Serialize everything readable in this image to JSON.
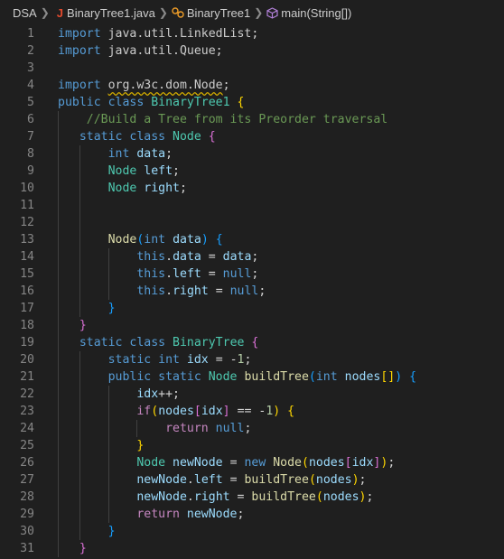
{
  "breadcrumb": {
    "folder": "DSA",
    "java_letter": "J",
    "file": "BinaryTree1.java",
    "class_name": "BinaryTree1",
    "method": "main(String[])"
  },
  "icons": [
    "chevron-right-icon",
    "java-file-icon",
    "class-icon",
    "method-cube-icon"
  ],
  "colors": {
    "background": "#1f1f1f",
    "keyword": "#569cd6",
    "type": "#4ec9b0",
    "comment": "#6a9955"
  },
  "lines": [
    {
      "n": "1",
      "t": [
        [
          "import ",
          "kw"
        ],
        [
          "java.util.LinkedList",
          "pkg"
        ],
        [
          ";",
          "op"
        ]
      ]
    },
    {
      "n": "2",
      "t": [
        [
          "import ",
          "kw"
        ],
        [
          "java.util.Queue",
          "pkg"
        ],
        [
          ";",
          "op"
        ]
      ]
    },
    {
      "n": "3",
      "t": []
    },
    {
      "n": "4",
      "t": [
        [
          "import ",
          "kw"
        ],
        [
          "org.w3c.dom.Node",
          "pkg warn"
        ],
        [
          ";",
          "op"
        ]
      ]
    },
    {
      "n": "5",
      "t": [
        [
          "public ",
          "kw"
        ],
        [
          "class ",
          "kw"
        ],
        [
          "BinaryTree1 ",
          "ty"
        ],
        [
          "{",
          "p1"
        ]
      ]
    },
    {
      "n": "6",
      "t": [
        [
          "    ",
          ""
        ],
        [
          "//Build a Tree from its Preorder traversal",
          "cm"
        ]
      ]
    },
    {
      "n": "7",
      "t": [
        [
          "   ",
          ""
        ],
        [
          "static ",
          "kw"
        ],
        [
          "class ",
          "kw"
        ],
        [
          "Node ",
          "ty"
        ],
        [
          "{",
          "p2"
        ]
      ]
    },
    {
      "n": "8",
      "t": [
        [
          "       ",
          ""
        ],
        [
          "int ",
          "kw"
        ],
        [
          "data",
          "var"
        ],
        [
          ";",
          "op"
        ]
      ]
    },
    {
      "n": "9",
      "t": [
        [
          "       ",
          ""
        ],
        [
          "Node ",
          "ty"
        ],
        [
          "left",
          "var"
        ],
        [
          ";",
          "op"
        ]
      ]
    },
    {
      "n": "10",
      "t": [
        [
          "       ",
          ""
        ],
        [
          "Node ",
          "ty"
        ],
        [
          "right",
          "var"
        ],
        [
          ";",
          "op"
        ]
      ]
    },
    {
      "n": "11",
      "t": []
    },
    {
      "n": "12",
      "t": []
    },
    {
      "n": "13",
      "t": [
        [
          "       ",
          ""
        ],
        [
          "Node",
          "fn"
        ],
        [
          "(",
          "p3"
        ],
        [
          "int ",
          "kw"
        ],
        [
          "data",
          "var"
        ],
        [
          ") ",
          "p3"
        ],
        [
          "{",
          "p3"
        ]
      ]
    },
    {
      "n": "14",
      "t": [
        [
          "           ",
          ""
        ],
        [
          "this",
          "kw"
        ],
        [
          ".",
          "op"
        ],
        [
          "data",
          "var"
        ],
        [
          " = ",
          "op"
        ],
        [
          "data",
          "var"
        ],
        [
          ";",
          "op"
        ]
      ]
    },
    {
      "n": "15",
      "t": [
        [
          "           ",
          ""
        ],
        [
          "this",
          "kw"
        ],
        [
          ".",
          "op"
        ],
        [
          "left",
          "var"
        ],
        [
          " = ",
          "op"
        ],
        [
          "null",
          "kw"
        ],
        [
          ";",
          "op"
        ]
      ]
    },
    {
      "n": "16",
      "t": [
        [
          "           ",
          ""
        ],
        [
          "this",
          "kw"
        ],
        [
          ".",
          "op"
        ],
        [
          "right",
          "var"
        ],
        [
          " = ",
          "op"
        ],
        [
          "null",
          "kw"
        ],
        [
          ";",
          "op"
        ]
      ]
    },
    {
      "n": "17",
      "t": [
        [
          "       ",
          ""
        ],
        [
          "}",
          "p3"
        ]
      ]
    },
    {
      "n": "18",
      "t": [
        [
          "   ",
          ""
        ],
        [
          "}",
          "p2"
        ]
      ]
    },
    {
      "n": "19",
      "t": [
        [
          "   ",
          ""
        ],
        [
          "static ",
          "kw"
        ],
        [
          "class ",
          "kw"
        ],
        [
          "BinaryTree ",
          "ty"
        ],
        [
          "{",
          "p2"
        ]
      ]
    },
    {
      "n": "20",
      "t": [
        [
          "       ",
          ""
        ],
        [
          "static ",
          "kw"
        ],
        [
          "int ",
          "kw"
        ],
        [
          "idx",
          "var"
        ],
        [
          " = -",
          "op"
        ],
        [
          "1",
          "num"
        ],
        [
          ";",
          "op"
        ]
      ]
    },
    {
      "n": "21",
      "t": [
        [
          "       ",
          ""
        ],
        [
          "public ",
          "kw"
        ],
        [
          "static ",
          "kw"
        ],
        [
          "Node ",
          "ty"
        ],
        [
          "buildTree",
          "fn"
        ],
        [
          "(",
          "p3"
        ],
        [
          "int ",
          "kw"
        ],
        [
          "nodes",
          "var"
        ],
        [
          "[]",
          "p1"
        ],
        [
          ") ",
          "p3"
        ],
        [
          "{",
          "p3"
        ]
      ]
    },
    {
      "n": "22",
      "t": [
        [
          "           ",
          ""
        ],
        [
          "idx",
          "var"
        ],
        [
          "++;",
          "op"
        ]
      ]
    },
    {
      "n": "23",
      "t": [
        [
          "           ",
          ""
        ],
        [
          "if",
          "ctl"
        ],
        [
          "(",
          "p1"
        ],
        [
          "nodes",
          "var"
        ],
        [
          "[",
          "p2"
        ],
        [
          "idx",
          "var"
        ],
        [
          "]",
          "p2"
        ],
        [
          " == -",
          "op"
        ],
        [
          "1",
          "num"
        ],
        [
          ") ",
          "p1"
        ],
        [
          "{",
          "p1"
        ]
      ]
    },
    {
      "n": "24",
      "t": [
        [
          "               ",
          ""
        ],
        [
          "return ",
          "ctl"
        ],
        [
          "null",
          "kw"
        ],
        [
          ";",
          "op"
        ]
      ]
    },
    {
      "n": "25",
      "t": [
        [
          "           ",
          ""
        ],
        [
          "}",
          "p1"
        ]
      ]
    },
    {
      "n": "26",
      "t": [
        [
          "           ",
          ""
        ],
        [
          "Node ",
          "ty"
        ],
        [
          "newNode",
          "var"
        ],
        [
          " = ",
          "op"
        ],
        [
          "new ",
          "kw"
        ],
        [
          "Node",
          "fn"
        ],
        [
          "(",
          "p1"
        ],
        [
          "nodes",
          "var"
        ],
        [
          "[",
          "p2"
        ],
        [
          "idx",
          "var"
        ],
        [
          "]",
          "p2"
        ],
        [
          ")",
          "p1"
        ],
        [
          ";",
          "op"
        ]
      ]
    },
    {
      "n": "27",
      "t": [
        [
          "           ",
          ""
        ],
        [
          "newNode",
          "var"
        ],
        [
          ".",
          "op"
        ],
        [
          "left",
          "var"
        ],
        [
          " = ",
          "op"
        ],
        [
          "buildTree",
          "fn"
        ],
        [
          "(",
          "p1"
        ],
        [
          "nodes",
          "var"
        ],
        [
          ")",
          "p1"
        ],
        [
          ";",
          "op"
        ]
      ]
    },
    {
      "n": "28",
      "t": [
        [
          "           ",
          ""
        ],
        [
          "newNode",
          "var"
        ],
        [
          ".",
          "op"
        ],
        [
          "right",
          "var"
        ],
        [
          " = ",
          "op"
        ],
        [
          "buildTree",
          "fn"
        ],
        [
          "(",
          "p1"
        ],
        [
          "nodes",
          "var"
        ],
        [
          ")",
          "p1"
        ],
        [
          ";",
          "op"
        ]
      ]
    },
    {
      "n": "29",
      "t": [
        [
          "           ",
          ""
        ],
        [
          "return ",
          "ctl"
        ],
        [
          "newNode",
          "var"
        ],
        [
          ";",
          "op"
        ]
      ]
    },
    {
      "n": "30",
      "t": [
        [
          "       ",
          ""
        ],
        [
          "}",
          "p3"
        ]
      ]
    },
    {
      "n": "31",
      "t": [
        [
          "   ",
          ""
        ],
        [
          "}",
          "p2"
        ]
      ]
    }
  ]
}
